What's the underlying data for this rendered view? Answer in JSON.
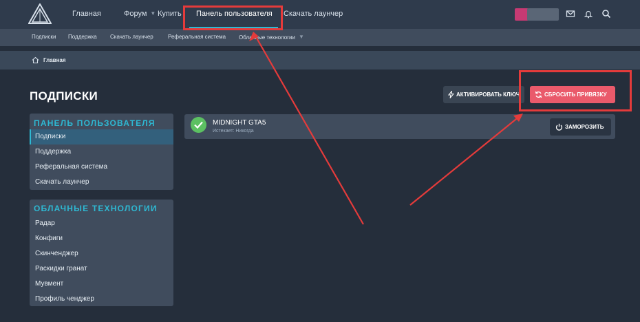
{
  "topnav": {
    "items": [
      {
        "label": "Главная"
      },
      {
        "label": "Форум"
      },
      {
        "label": "Купить"
      },
      {
        "label": "Панель пользователя"
      },
      {
        "label": "Скачать лаунчер"
      }
    ],
    "icons": [
      "mail-icon",
      "bell-icon",
      "search-icon"
    ]
  },
  "subnav": {
    "items": [
      {
        "label": "Подписки"
      },
      {
        "label": "Поддержка"
      },
      {
        "label": "Скачать лаунчер"
      },
      {
        "label": "Реферальная система"
      },
      {
        "label": "Облачные технологии"
      }
    ]
  },
  "breadcrumb": {
    "label": "Главная"
  },
  "page": {
    "title": "ПОДПИСКИ",
    "activate_label": "АКТИВИРОВАТЬ КЛЮЧ",
    "reset_label": "СБРОСИТЬ ПРИВЯЗКУ"
  },
  "sidebar": {
    "panel1": {
      "title": "ПАНЕЛЬ ПОЛЬЗОВАТЕЛЯ",
      "items": [
        {
          "label": "Подписки"
        },
        {
          "label": "Поддержка"
        },
        {
          "label": "Реферальная система"
        },
        {
          "label": "Скачать лаунчер"
        }
      ]
    },
    "panel2": {
      "title": "ОБЛАЧНЫЕ ТЕХНОЛОГИИ",
      "items": [
        {
          "label": "Радар"
        },
        {
          "label": "Конфиги"
        },
        {
          "label": "Скинченджер"
        },
        {
          "label": "Раскидки гранат"
        },
        {
          "label": "Мувмент"
        },
        {
          "label": "Профиль ченджер"
        }
      ]
    }
  },
  "subscription": {
    "name": "MIDNIGHT GTA5",
    "expires": "Истекает: Никогда",
    "freeze_label": "ЗАМОРОЗИТЬ"
  },
  "colors": {
    "accent": "#2eb8d2",
    "danger": "#ea5a6b",
    "success": "#5cc062",
    "annotation": "#e53b3b"
  }
}
